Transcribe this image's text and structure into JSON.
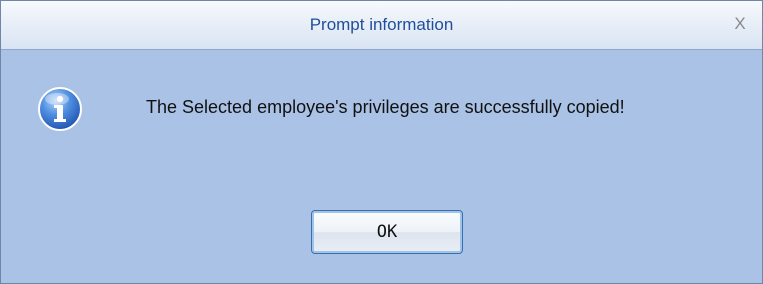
{
  "window": {
    "title": "Prompt information",
    "close_glyph": "X"
  },
  "dialog": {
    "icon": "info-icon",
    "message": "The Selected employee's privileges are successfully copied!",
    "ok_label": "OK"
  },
  "colors": {
    "background": "#a9c2e6",
    "title_text": "#1f4f9a",
    "button_border": "#3b6fa8"
  }
}
